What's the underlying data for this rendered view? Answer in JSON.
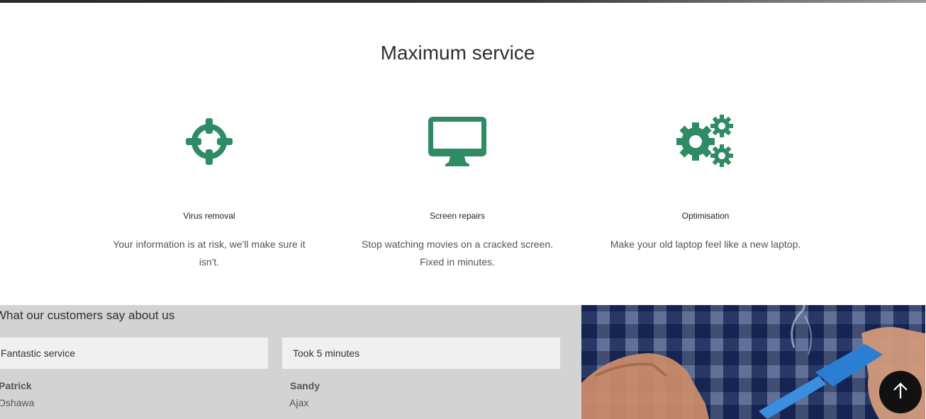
{
  "services": {
    "title": "Maximum service",
    "items": [
      {
        "icon": "crosshair-icon",
        "title": "Virus removal",
        "description": "Your information is at risk, we'll make sure it isn't."
      },
      {
        "icon": "monitor-icon",
        "title": "Screen repairs",
        "description": "Stop watching movies on a cracked screen. Fixed in minutes."
      },
      {
        "icon": "gears-icon",
        "title": "Optimisation",
        "description": "Make your old laptop feel like a new laptop."
      }
    ]
  },
  "testimonials": {
    "heading": "What our customers say about us",
    "items": [
      {
        "quote": "Fantastic service",
        "name": "Patrick",
        "city": "Oshawa"
      },
      {
        "quote": "Took 5 minutes",
        "name": "Sandy",
        "city": "Ajax"
      }
    ]
  },
  "photo": {
    "description": "soldering-iron-photo"
  },
  "scroll_top": {
    "icon": "arrow-up-icon"
  },
  "colors": {
    "accent": "#2e8b63",
    "testimonial_bg": "#d3d3d3",
    "quote_bg": "#f0f0f0"
  }
}
